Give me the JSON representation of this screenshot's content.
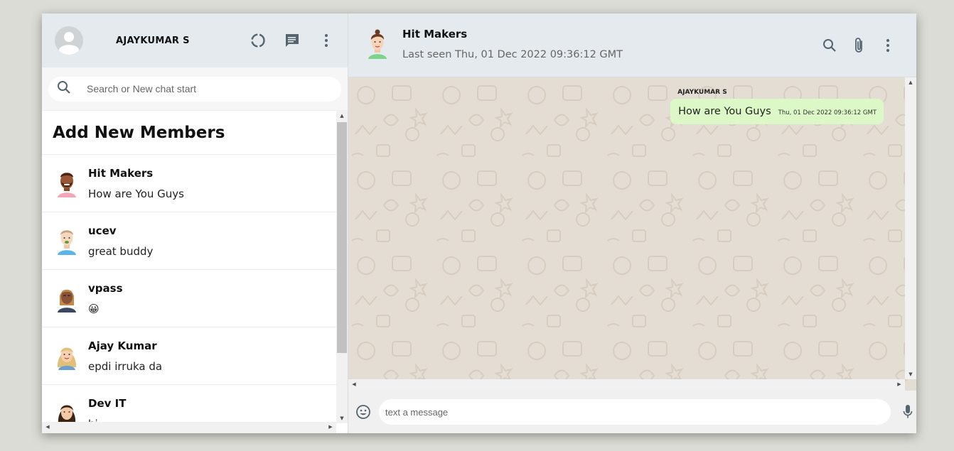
{
  "sidebar": {
    "user_name": "AJAYKUMAR S",
    "icons": [
      "user-avatar-icon",
      "status-icon",
      "new-chat-icon",
      "more-vert-icon"
    ],
    "search": {
      "placeholder": "Search or New chat start"
    },
    "list_title": "Add New Members",
    "chats": [
      {
        "name": "Hit Makers",
        "last": "How are You Guys",
        "avatar": "avatar-bearded-man"
      },
      {
        "name": "ucev",
        "last": "great buddy",
        "avatar": "avatar-young-man"
      },
      {
        "name": "vpass",
        "last": "😀",
        "avatar": "avatar-woman-dark"
      },
      {
        "name": "Ajay Kumar",
        "last": "epdi irruka da",
        "avatar": "avatar-woman-blonde"
      },
      {
        "name": "Dev IT",
        "last": "hi",
        "avatar": "avatar-woman-brunette"
      }
    ]
  },
  "chat": {
    "contact_name": "Hit Makers",
    "contact_status": "Last seen Thu, 01 Dec 2022 09:36:12 GMT",
    "icons": [
      "search-icon",
      "attach-icon",
      "more-vert-icon"
    ],
    "messages": [
      {
        "sender": "AJAYKUMAR S",
        "text": "How are You Guys",
        "time": "Thu, 01 Dec 2022 09:36:12 GMT"
      }
    ],
    "input": {
      "placeholder": "text a message"
    }
  },
  "colors": {
    "header_bg": "#e5eaef",
    "chat_bg": "#e4ddd3",
    "bubble": "#dcf8c6"
  }
}
